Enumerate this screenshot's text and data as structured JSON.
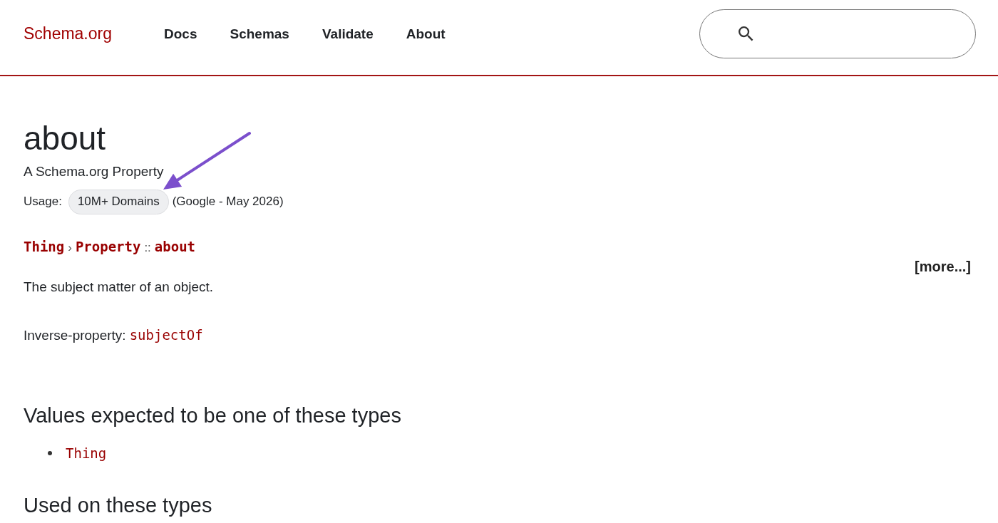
{
  "header": {
    "logo": "Schema.org",
    "nav": [
      "Docs",
      "Schemas",
      "Validate",
      "About"
    ]
  },
  "term": {
    "title": "about",
    "subtitle": "A Schema.org Property",
    "usage": {
      "label": "Usage:",
      "badge": "10M+ Domains",
      "source": "(Google - May 2026)"
    },
    "breadcrumb": [
      {
        "kind": "link",
        "text": "Thing"
      },
      {
        "kind": "separator",
        "text": "›"
      },
      {
        "kind": "link",
        "text": "Property"
      },
      {
        "kind": "separator",
        "text": "::"
      },
      {
        "kind": "link",
        "text": "about"
      }
    ],
    "more_link": "[more...]",
    "description": "The subject matter of an object.",
    "inverse_property": {
      "label": "Inverse-property:",
      "value": "subjectOf"
    }
  },
  "sections": [
    {
      "heading": "Values expected to be one of these types",
      "items": [
        "Thing"
      ]
    },
    {
      "heading": "Used on these types"
    }
  ]
}
